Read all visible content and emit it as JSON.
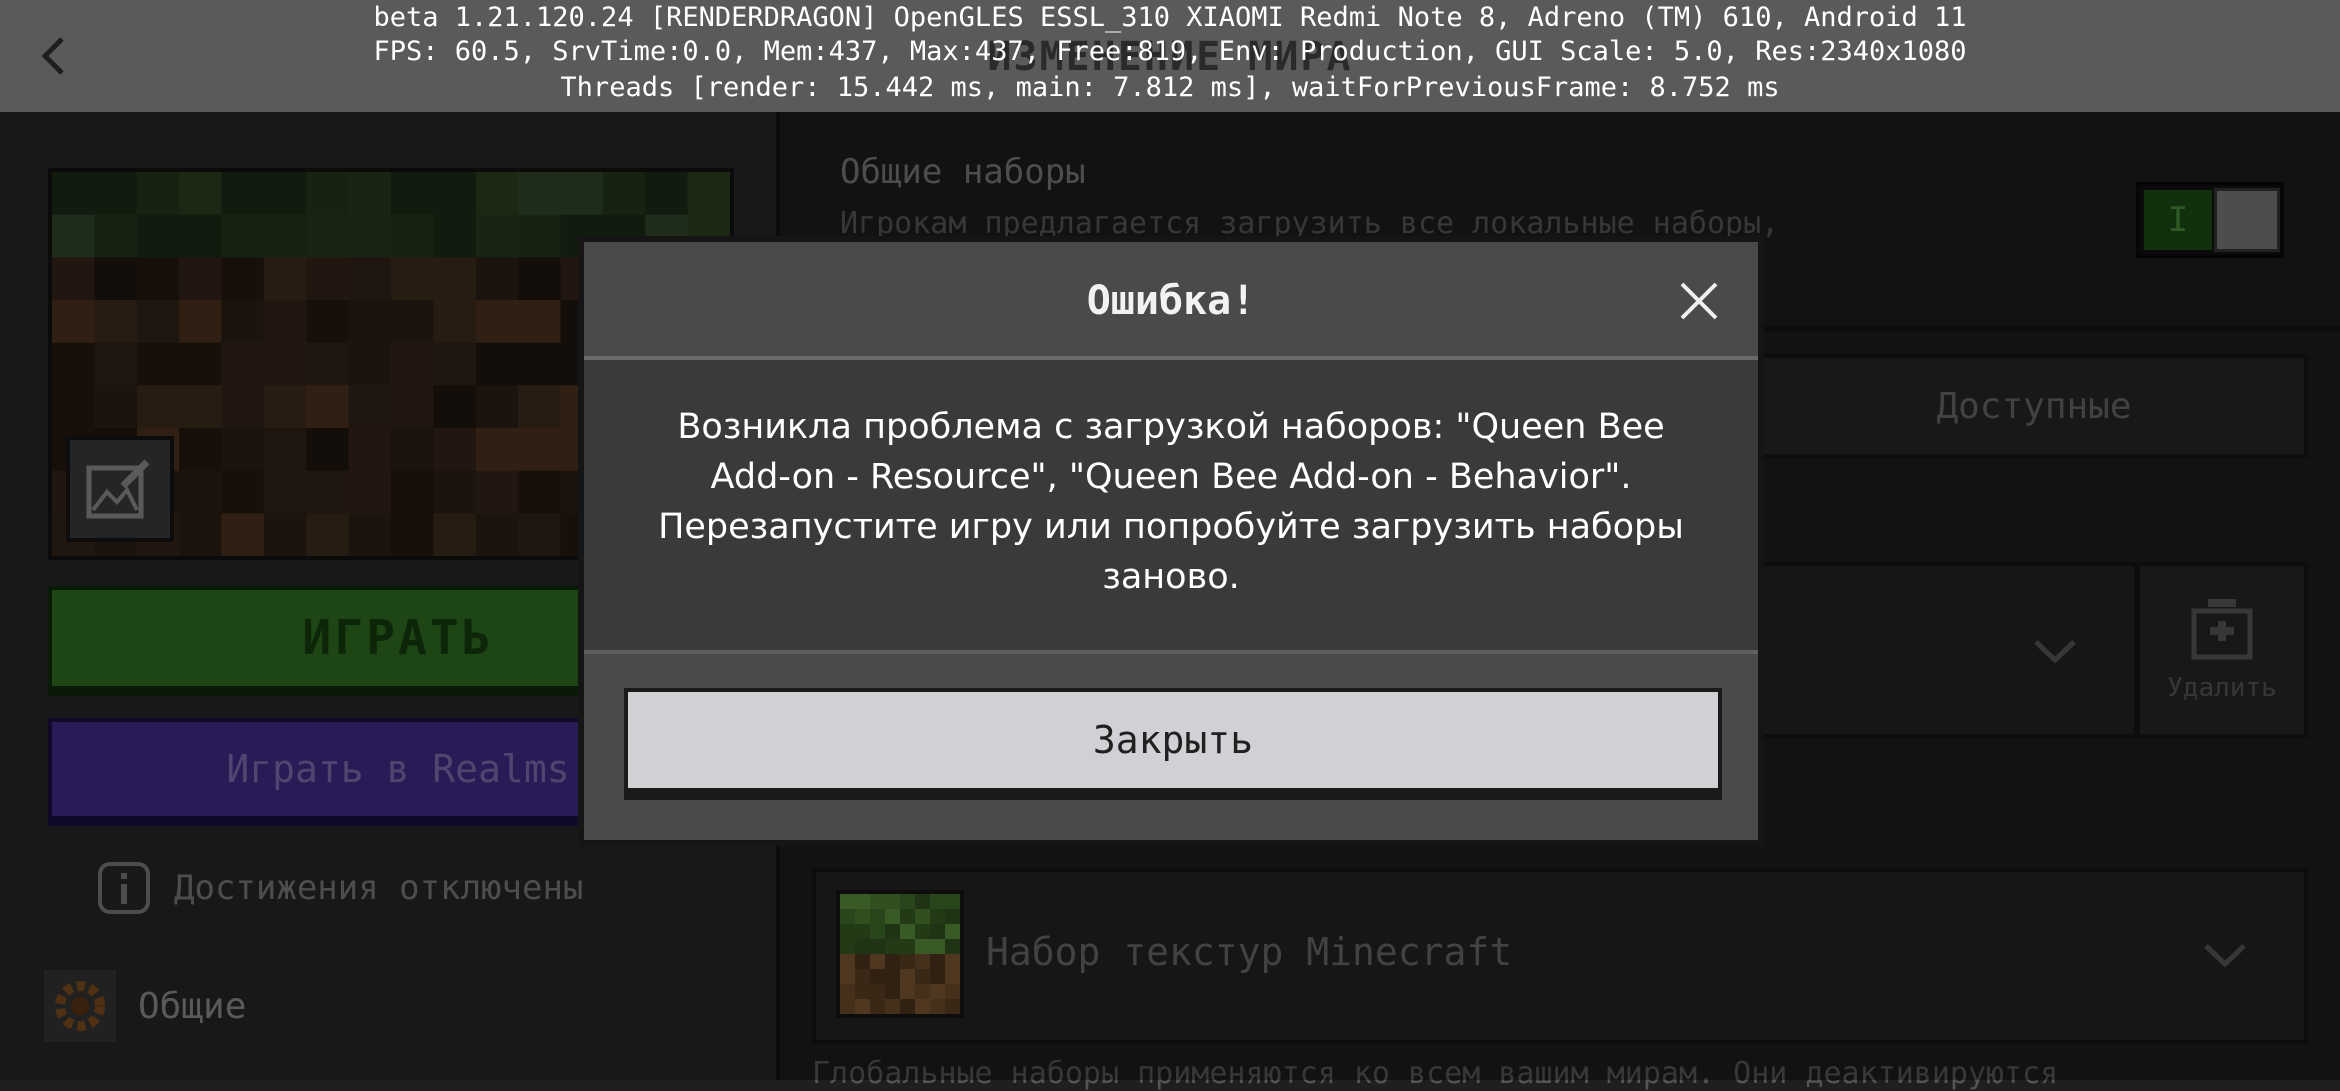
{
  "debug": {
    "line1": "beta 1.21.120.24 [RENDERDRAGON] OpenGLES ESSL_310 XIAOMI Redmi Note 8, Adreno (TM) 610, Android 11",
    "line2": "FPS: 60.5, SrvTime:0.0, Mem:437, Max:437, Free:819, Env: Production, GUI Scale: 5.0, Res:2340x1080",
    "line3": "Threads [render: 15.442 ms, main: 7.812 ms], waitForPreviousFrame: 8.752 ms"
  },
  "header": {
    "title": "ИЗМЕНЕНИЕ МИРА",
    "back_icon": "chevron-left-icon"
  },
  "left": {
    "play_label": "ИГРАТЬ",
    "realms_label": "Играть в Realms",
    "achievements_label": "Достижения отключены",
    "general_label": "Общие",
    "colors": {
      "play": "#2e6b20",
      "realms": "#3f2a85"
    }
  },
  "right": {
    "shared_packs_title": "Общие наборы",
    "shared_packs_desc": "Игрокам предлагается загрузить все локальные наборы,",
    "toggle_on_glyph": "I",
    "available_tab": "Доступные",
    "delete_label": "Удалить",
    "pack_2_name": "Набор текстур Minecraft",
    "global_desc": "Глобальные наборы применяются ко всем вашим мирам. Они деактивируются"
  },
  "dialog": {
    "title": "Ошибка!",
    "message_lines": [
      "Возникла проблема с загрузкой наборов: \"Queen Bee",
      "Add-on - Resource\", \"Queen Bee Add-on - Behavior\".",
      "Перезапустите игру или попробуйте загрузить наборы",
      "заново."
    ],
    "close_button": "Закрыть",
    "close_icon": "close-icon"
  }
}
